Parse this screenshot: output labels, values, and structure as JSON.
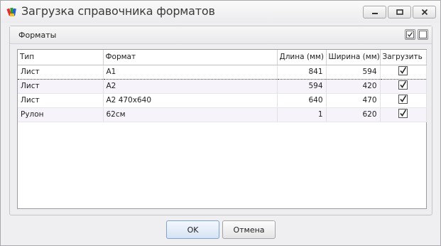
{
  "window": {
    "title": "Загрузка справочника форматов",
    "icon": "palette-app-icon"
  },
  "group": {
    "title": "Форматы"
  },
  "table": {
    "columns": [
      "Тип",
      "Формат",
      "Длина (мм)",
      "Ширина (мм)",
      "Загрузить"
    ],
    "rows": [
      {
        "type": "Лист",
        "format": "A1",
        "length": "841",
        "width": "594",
        "load": true
      },
      {
        "type": "Лист",
        "format": "A2",
        "length": "594",
        "width": "420",
        "load": true
      },
      {
        "type": "Лист",
        "format": "A2 470x640",
        "length": "640",
        "width": "470",
        "load": true
      },
      {
        "type": "Рулон",
        "format": "62см",
        "length": "1",
        "width": "620",
        "load": true
      }
    ]
  },
  "buttons": {
    "ok": "OK",
    "cancel": "Отмена"
  },
  "colors": {
    "row_alt": "#f6f3fb",
    "ok_border": "#7fa3cf"
  }
}
